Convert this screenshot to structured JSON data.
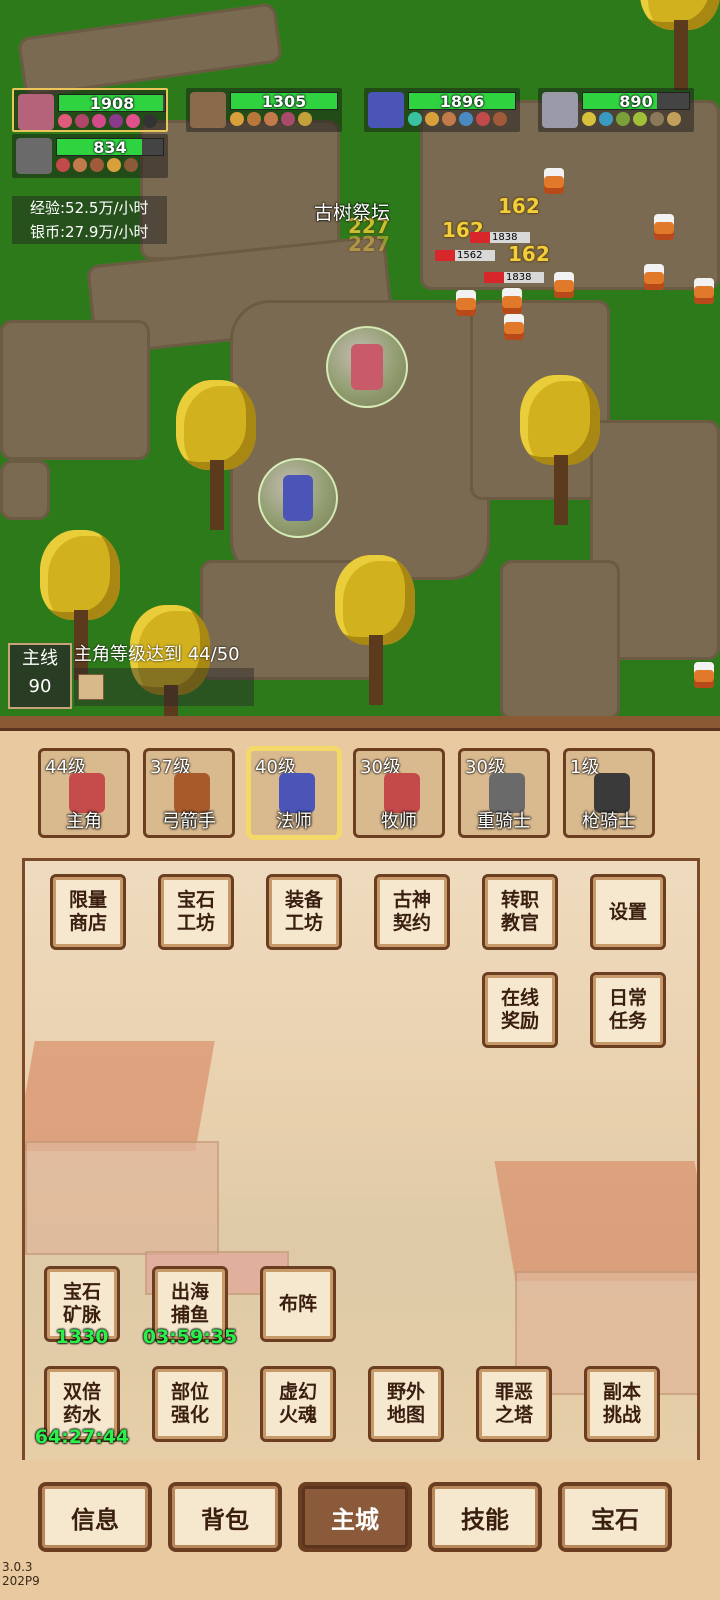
{
  "party": [
    {
      "hp": "1908",
      "hp_frac": 0.98,
      "portrait": "swordsman-portrait-icon"
    },
    {
      "hp": "1305",
      "hp_frac": 1.0,
      "portrait": "archer-portrait-icon"
    },
    {
      "hp": "1896",
      "hp_frac": 1.0,
      "portrait": "mage-portrait-icon"
    },
    {
      "hp": "890",
      "hp_frac": 0.7,
      "portrait": "priest-portrait-icon"
    },
    {
      "hp": "834",
      "hp_frac": 0.8,
      "portrait": "knight-portrait-icon"
    }
  ],
  "rates": {
    "exp": "经验:52.5万/小时",
    "silver": "银币:27.9万/小时"
  },
  "map": {
    "location": "古树祭坛",
    "damage": [
      "162",
      "162",
      "162",
      "227",
      "227"
    ],
    "enemy_hp": [
      "1838",
      "1562",
      "1838"
    ]
  },
  "quest": {
    "tag_label": "主线",
    "tag_num": "90",
    "text": "主角等级达到 44/50"
  },
  "heroes": [
    {
      "level": "44级",
      "name": "主角",
      "color": "#c64b4b"
    },
    {
      "level": "37级",
      "name": "弓箭手",
      "color": "#a85a2a"
    },
    {
      "level": "40级",
      "name": "法师",
      "color": "#4b55b8"
    },
    {
      "level": "30级",
      "name": "牧师",
      "color": "#c44a4a"
    },
    {
      "level": "30级",
      "name": "重骑士",
      "color": "#6a6a6a"
    },
    {
      "level": "1级",
      "name": "枪骑士",
      "color": "#3a3a3a"
    }
  ],
  "buttons": {
    "shop": "限量\n商店",
    "gem_workshop": "宝石\n工坊",
    "equip_workshop": "装备\n工坊",
    "god_contract": "古神\n契约",
    "job_change": "转职\n教官",
    "settings": "设置",
    "online_reward": "在线\n奖励",
    "daily_tasks": "日常\n任务",
    "gem_mine": "宝石\n矿脉",
    "fishing": "出海\n捕鱼",
    "formation": "布阵",
    "double_potion": "双倍\n药水",
    "part_enhance": "部位\n强化",
    "illusion_soul": "虚幻\n火魂",
    "field_map": "野外\n地图",
    "sin_tower": "罪恶\n之塔",
    "dungeon": "副本\n挑战"
  },
  "timers": {
    "gem_mine": "1330",
    "fishing": "03:59:35",
    "double_potion": "64:27:44"
  },
  "nav": [
    "信息",
    "背包",
    "主城",
    "技能",
    "宝石"
  ],
  "nav_active": 2,
  "version": "3.0.3\n202P9"
}
